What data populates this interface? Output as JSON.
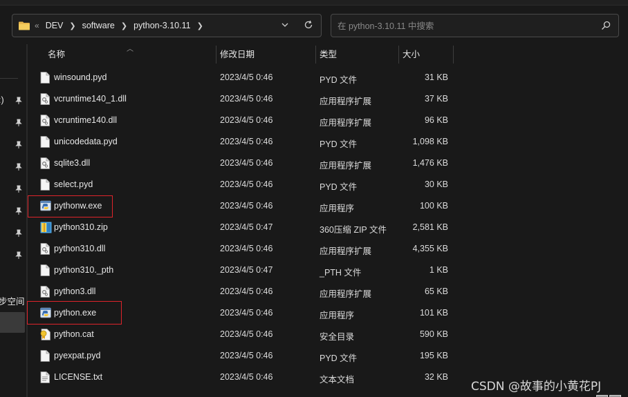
{
  "address_bar": {
    "overflow_glyph": "«",
    "crumbs": [
      "DEV",
      "software",
      "python-3.10.11"
    ]
  },
  "search": {
    "placeholder": "在 python-3.10.11 中搜索"
  },
  "nav_pane": {
    "partial_label_top": ":)",
    "partial_label_bottom": "步空间"
  },
  "columns": {
    "name": "名称",
    "modified": "修改日期",
    "type": "类型",
    "size": "大小"
  },
  "files": [
    {
      "name": "winsound.pyd",
      "modified": "2023/4/5 0:46",
      "type": "PYD 文件",
      "size": "31 KB",
      "icon": "generic-file-icon"
    },
    {
      "name": "vcruntime140_1.dll",
      "modified": "2023/4/5 0:46",
      "type": "应用程序扩展",
      "size": "37 KB",
      "icon": "dll-file-icon"
    },
    {
      "name": "vcruntime140.dll",
      "modified": "2023/4/5 0:46",
      "type": "应用程序扩展",
      "size": "96 KB",
      "icon": "dll-file-icon"
    },
    {
      "name": "unicodedata.pyd",
      "modified": "2023/4/5 0:46",
      "type": "PYD 文件",
      "size": "1,098 KB",
      "icon": "generic-file-icon"
    },
    {
      "name": "sqlite3.dll",
      "modified": "2023/4/5 0:46",
      "type": "应用程序扩展",
      "size": "1,476 KB",
      "icon": "dll-file-icon"
    },
    {
      "name": "select.pyd",
      "modified": "2023/4/5 0:46",
      "type": "PYD 文件",
      "size": "30 KB",
      "icon": "generic-file-icon"
    },
    {
      "name": "pythonw.exe",
      "modified": "2023/4/5 0:46",
      "type": "应用程序",
      "size": "100 KB",
      "icon": "python-exe-icon"
    },
    {
      "name": "python310.zip",
      "modified": "2023/4/5 0:47",
      "type": "360压缩 ZIP 文件",
      "size": "2,581 KB",
      "icon": "zip-archive-icon"
    },
    {
      "name": "python310.dll",
      "modified": "2023/4/5 0:46",
      "type": "应用程序扩展",
      "size": "4,355 KB",
      "icon": "dll-file-icon"
    },
    {
      "name": "python310._pth",
      "modified": "2023/4/5 0:47",
      "type": "_PTH 文件",
      "size": "1 KB",
      "icon": "generic-file-icon"
    },
    {
      "name": "python3.dll",
      "modified": "2023/4/5 0:46",
      "type": "应用程序扩展",
      "size": "65 KB",
      "icon": "dll-file-icon"
    },
    {
      "name": "python.exe",
      "modified": "2023/4/5 0:46",
      "type": "应用程序",
      "size": "101 KB",
      "icon": "python-exe-icon"
    },
    {
      "name": "python.cat",
      "modified": "2023/4/5 0:46",
      "type": "安全目录",
      "size": "590 KB",
      "icon": "security-catalog-icon"
    },
    {
      "name": "pyexpat.pyd",
      "modified": "2023/4/5 0:46",
      "type": "PYD 文件",
      "size": "195 KB",
      "icon": "generic-file-icon"
    },
    {
      "name": "LICENSE.txt",
      "modified": "2023/4/5 0:46",
      "type": "文本文档",
      "size": "32 KB",
      "icon": "text-file-icon"
    }
  ],
  "highlight_color": "#e0242b",
  "watermark": "CSDN @故事的小黄花PJ"
}
